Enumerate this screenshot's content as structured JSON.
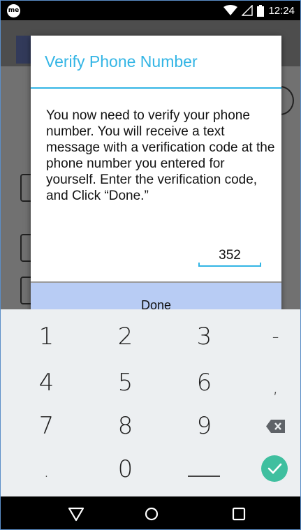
{
  "status_bar": {
    "app_icon_text": "me",
    "time": "12:24",
    "icons": [
      "wifi-icon",
      "signal-icon",
      "battery-icon"
    ]
  },
  "dialog": {
    "title": "Verify Phone Number",
    "message": "You now need to verify your phone number. You will receive a text message with a verification code at the phone number you entered for yourself. Enter the verification code, and Click “Done.”",
    "code_value": "352",
    "done_label": "Done"
  },
  "keyboard": {
    "rows": [
      [
        "1",
        "2",
        "3",
        "-"
      ],
      [
        "4",
        "5",
        "6",
        ","
      ],
      [
        "7",
        "8",
        "9",
        "backspace"
      ],
      [
        ".",
        "0",
        "_",
        "done-check"
      ]
    ]
  },
  "nav_bar": {
    "icons": [
      "back-icon",
      "home-icon",
      "recents-icon"
    ]
  },
  "colors": {
    "accent": "#33b5e5",
    "done_button_bg": "#b8ccf4",
    "keyboard_bg": "#eceff1",
    "check_green": "#3fbf9f"
  }
}
